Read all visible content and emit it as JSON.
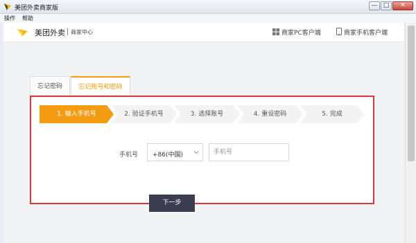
{
  "window": {
    "title": "美团外卖商家版",
    "icon": "meituan-logo-icon",
    "buttons": {
      "minimize": "—",
      "maximize": "□",
      "close": "✕"
    }
  },
  "menubar": {
    "items": [
      "操作",
      "帮助"
    ]
  },
  "header": {
    "brand": "美团外卖",
    "subtitle": "商家中心",
    "links": [
      {
        "label": "商家PC客户端",
        "icon": "windows-icon"
      },
      {
        "label": "商家手机客户端",
        "icon": "mobile-phone-icon"
      }
    ]
  },
  "tabs": [
    {
      "label": "忘记密码",
      "active": false
    },
    {
      "label": "忘记账号和密码",
      "active": true
    }
  ],
  "steps": [
    {
      "label": "1. 输入手机号",
      "active": true
    },
    {
      "label": "2. 验证手机号",
      "active": false
    },
    {
      "label": "3. 选择账号",
      "active": false
    },
    {
      "label": "4. 重设密码",
      "active": false
    },
    {
      "label": "5. 完成",
      "active": false
    }
  ],
  "form": {
    "phone_label": "手机号",
    "country_code": "+86(中国)",
    "phone_placeholder": "手机号",
    "phone_value": "",
    "next_button": "下一步"
  },
  "colors": {
    "accent": "#f39c12",
    "highlight_border": "#d9363b",
    "button": "#3b3d52"
  }
}
